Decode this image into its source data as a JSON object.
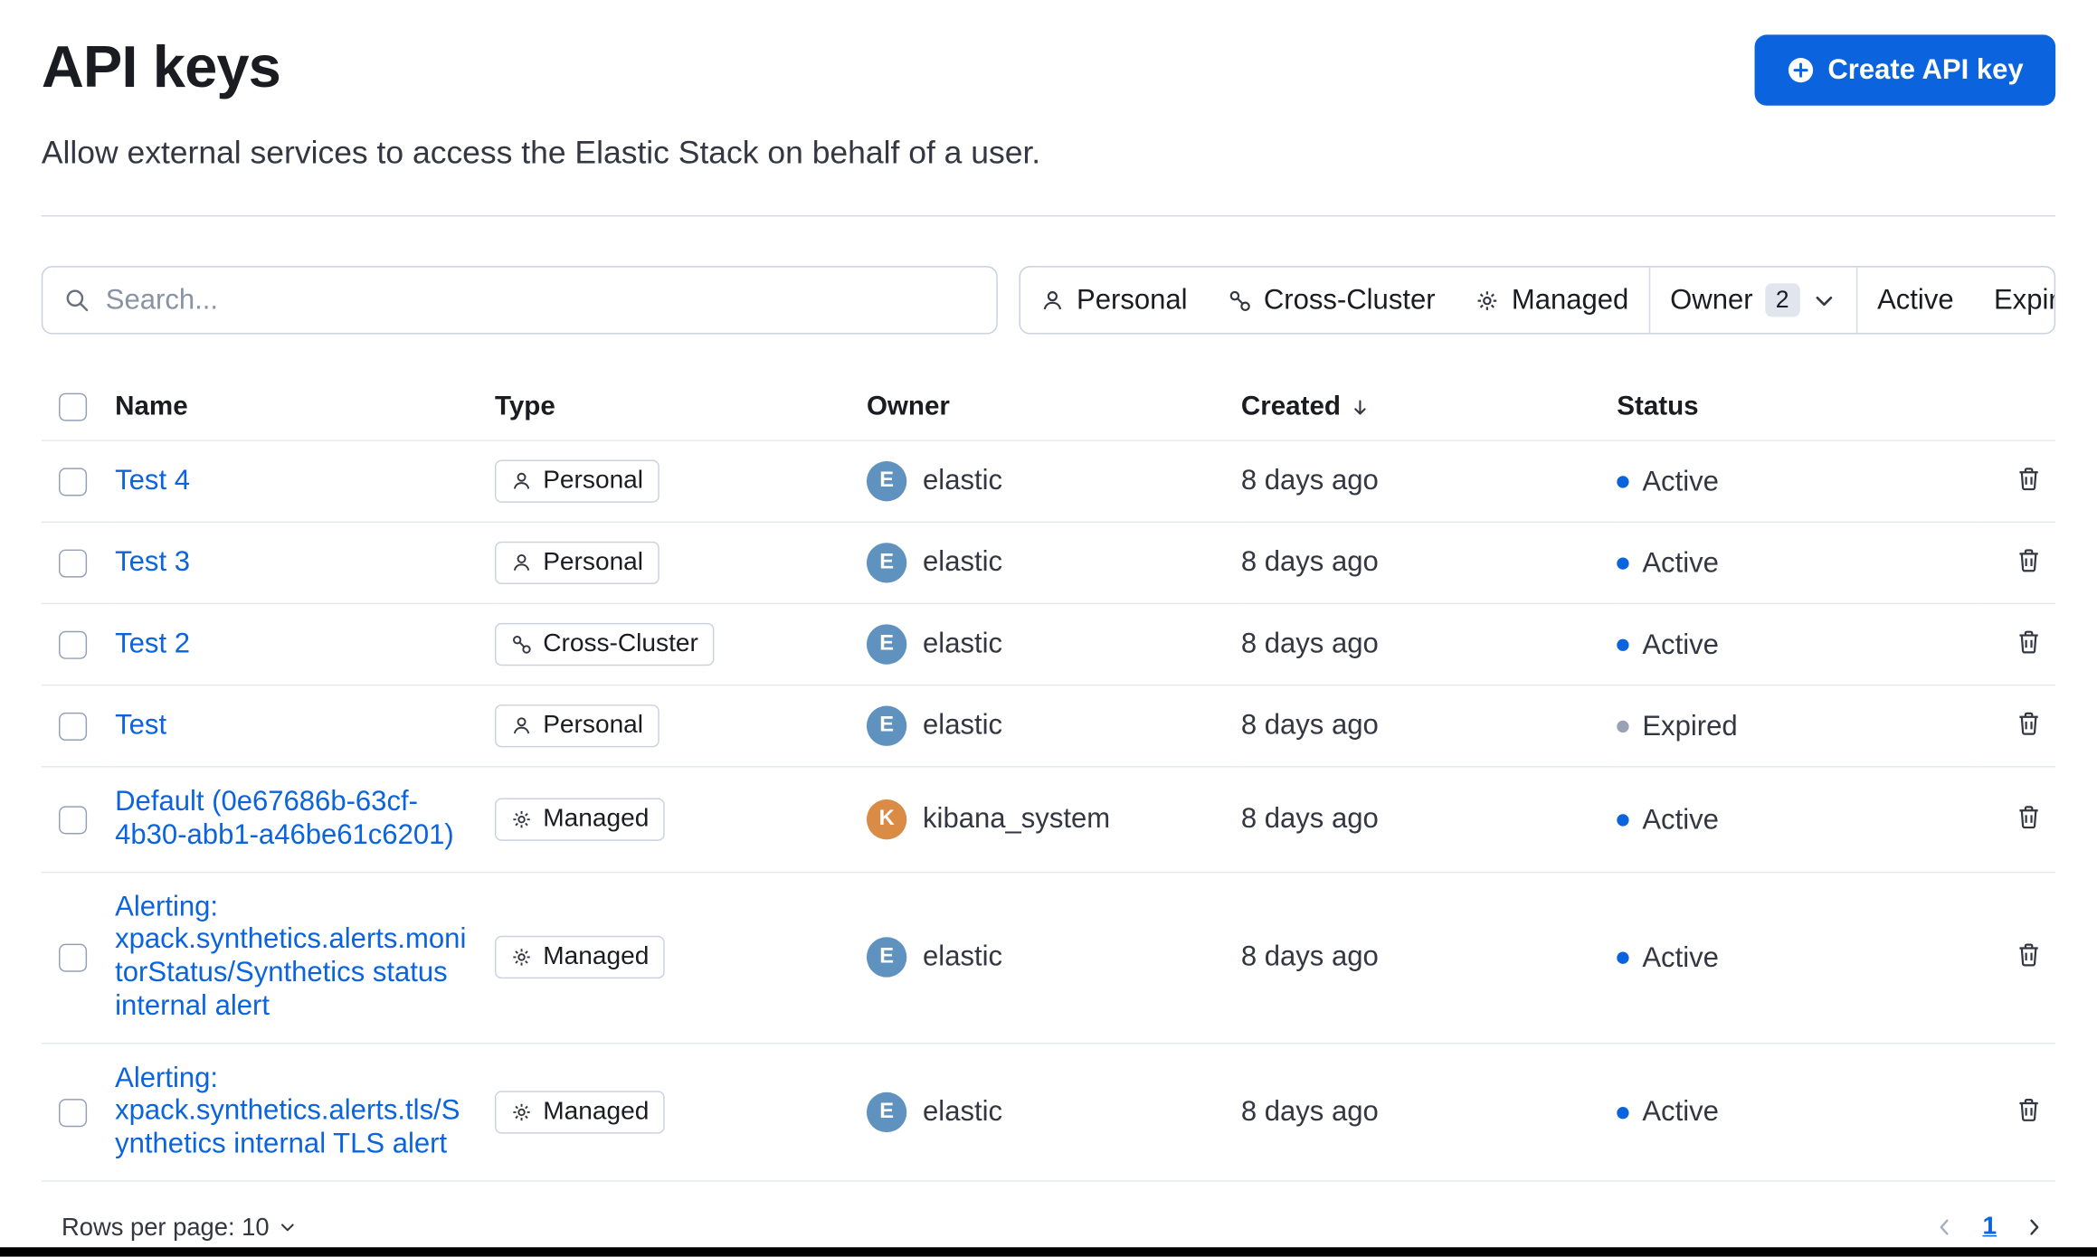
{
  "page": {
    "title": "API keys",
    "subtitle": "Allow external services to access the Elastic Stack on behalf of a user.",
    "create_button_label": "Create API key"
  },
  "search": {
    "placeholder": "Search..."
  },
  "filter_bar": {
    "personal_label": "Personal",
    "cross_cluster_label": "Cross-Cluster",
    "managed_label": "Managed",
    "owner_label": "Owner",
    "owner_count": "2",
    "active_label": "Active",
    "expired_label": "Expired"
  },
  "table": {
    "headers": {
      "name": "Name",
      "type": "Type",
      "owner": "Owner",
      "created": "Created",
      "status": "Status"
    },
    "sorted_column": "Created",
    "sort_direction": "descending",
    "rows": [
      {
        "name": "Test 4",
        "type": "Personal",
        "type_icon": "user-icon",
        "owner": "elastic",
        "owner_initial": "E",
        "avatar_color": "#6092C0",
        "created": "8 days ago",
        "status": "Active",
        "status_color": "#0B64DD"
      },
      {
        "name": "Test 3",
        "type": "Personal",
        "type_icon": "user-icon",
        "owner": "elastic",
        "owner_initial": "E",
        "avatar_color": "#6092C0",
        "created": "8 days ago",
        "status": "Active",
        "status_color": "#0B64DD"
      },
      {
        "name": "Test 2",
        "type": "Cross-Cluster",
        "type_icon": "cluster-icon",
        "owner": "elastic",
        "owner_initial": "E",
        "avatar_color": "#6092C0",
        "created": "8 days ago",
        "status": "Active",
        "status_color": "#0B64DD"
      },
      {
        "name": "Test",
        "type": "Personal",
        "type_icon": "user-icon",
        "owner": "elastic",
        "owner_initial": "E",
        "avatar_color": "#6092C0",
        "created": "8 days ago",
        "status": "Expired",
        "status_color": "#98A2B3"
      },
      {
        "name": "Default (0e67686b-63cf-4b30-abb1-a46be61c6201)",
        "type": "Managed",
        "type_icon": "gear-icon",
        "owner": "kibana_system",
        "owner_initial": "K",
        "avatar_color": "#DA8B45",
        "created": "8 days ago",
        "status": "Active",
        "status_color": "#0B64DD"
      },
      {
        "name": "Alerting: xpack.synthetics.alerts.monitorStatus/Synthetics status internal alert",
        "type": "Managed",
        "type_icon": "gear-icon",
        "owner": "elastic",
        "owner_initial": "E",
        "avatar_color": "#6092C0",
        "created": "8 days ago",
        "status": "Active",
        "status_color": "#0B64DD"
      },
      {
        "name": "Alerting: xpack.synthetics.alerts.tls/Synthetics internal TLS alert",
        "type": "Managed",
        "type_icon": "gear-icon",
        "owner": "elastic",
        "owner_initial": "E",
        "avatar_color": "#6092C0",
        "created": "8 days ago",
        "status": "Active",
        "status_color": "#0B64DD"
      }
    ]
  },
  "footer": {
    "rows_per_page_label": "Rows per page: 10",
    "current_page": "1"
  },
  "colors": {
    "primary": "#0B64DD",
    "link": "#0B64DD",
    "active_status_dot": "#0B64DD",
    "expired_status_dot": "#98A2B3",
    "avatar_elastic": "#6092C0",
    "avatar_kibana_system": "#DA8B45"
  }
}
